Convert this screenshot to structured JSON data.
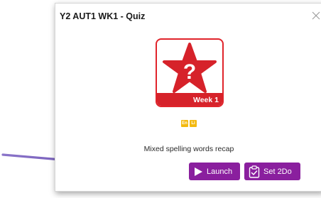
{
  "dialog": {
    "title": "Y2 AUT1 WK1 - Quiz",
    "close_icon": "close-icon"
  },
  "quiz_card": {
    "icon": "question-star-icon",
    "week_label": "Week 1",
    "colors": {
      "red": "#d6222a",
      "star": "#d6222a"
    }
  },
  "tags": [
    {
      "label": "En",
      "color": "#f3b90f"
    },
    {
      "label": "Li",
      "color": "#f3b90f"
    }
  ],
  "description": "Mixed spelling words recap",
  "actions": {
    "launch_label": "Launch",
    "launch_icon": "play-icon",
    "set2do_label": "Set 2Do",
    "set2do_icon": "clipboard-check-icon",
    "button_color": "#8a1f9e"
  },
  "annotation": {
    "icon": "pointer-arrow-icon",
    "color": "#7b5cb8"
  }
}
